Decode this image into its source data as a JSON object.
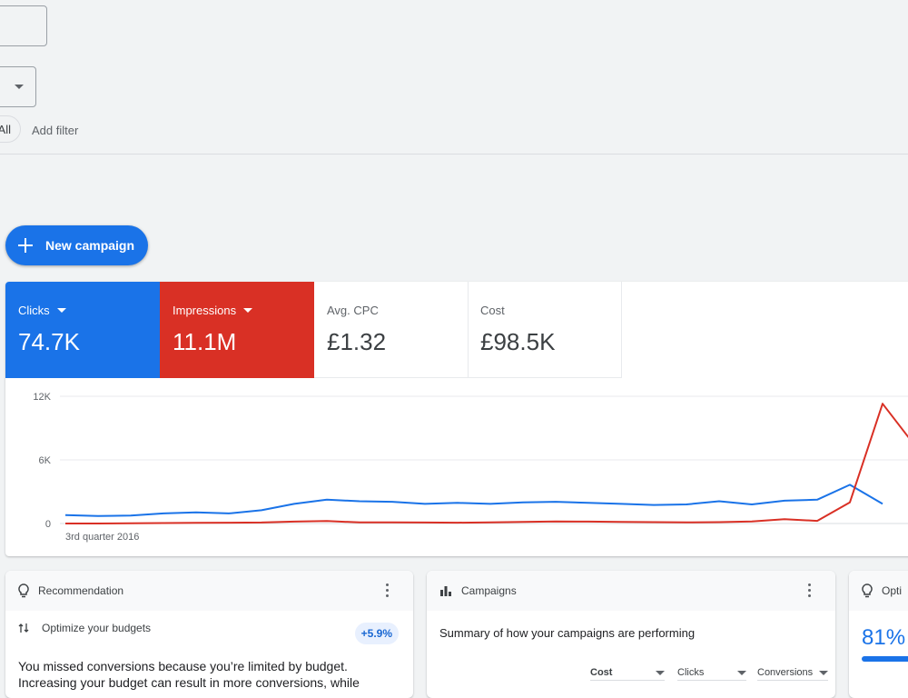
{
  "filters": {
    "chip_all": "All",
    "add_filter": "Add filter"
  },
  "new_campaign": {
    "label": "New campaign"
  },
  "metrics": [
    {
      "label": "Clicks",
      "value": "74.7K",
      "color": "#1a73e8"
    },
    {
      "label": "Impressions",
      "value": "11.1M",
      "color": "#d93025"
    },
    {
      "label": "Avg. CPC",
      "value": "£1.32"
    },
    {
      "label": "Cost",
      "value": "£98.5K"
    }
  ],
  "chart_data": {
    "type": "line",
    "y_ticks": [
      "12K",
      "6K",
      "0"
    ],
    "ylim": [
      0,
      12000
    ],
    "x_label": "3rd quarter 2016",
    "grid": true,
    "series": [
      {
        "name": "Clicks",
        "color": "#1a73e8",
        "values": [
          800,
          700,
          750,
          950,
          1050,
          950,
          1250,
          1850,
          2250,
          2100,
          2050,
          1850,
          1950,
          1850,
          2000,
          2050,
          1950,
          1850,
          1750,
          1800,
          2100,
          1800,
          2150,
          2250,
          3650,
          1850
        ]
      },
      {
        "name": "Impressions",
        "color": "#d93025",
        "values": [
          0,
          0,
          20,
          40,
          60,
          80,
          90,
          180,
          230,
          100,
          110,
          90,
          80,
          100,
          150,
          200,
          180,
          150,
          130,
          100,
          130,
          200,
          400,
          250,
          2000,
          11300,
          7300
        ]
      }
    ]
  },
  "cards": {
    "recommendation": {
      "title": "Recommendation",
      "item_title": "Optimize your budgets",
      "badge": "+5.9%",
      "text": "You missed conversions because you’re limited by budget. Increasing your budget can result in more conversions, while"
    },
    "campaigns": {
      "title": "Campaigns",
      "summary": "Summary of how your campaigns are performing",
      "dropdowns": [
        "Cost",
        "Clicks",
        "Conversions"
      ]
    },
    "optimization": {
      "title": "Opti",
      "score": "81%",
      "score_value": 0.81
    }
  }
}
